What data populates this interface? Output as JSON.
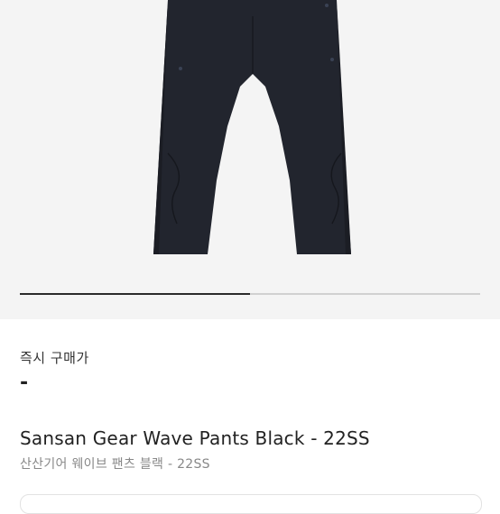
{
  "image_carousel": {
    "progress_fraction": 0.5,
    "alt": "pants-photo"
  },
  "price": {
    "label": "즉시 구매가",
    "value": "-"
  },
  "product": {
    "title_en": "Sansan Gear Wave Pants Black - 22SS",
    "title_ko": "산산기어 웨이브 팬츠 블랙 - 22SS"
  },
  "colors": {
    "background": "#f4f4f4",
    "pants": "#22252e",
    "progress_active": "#2a2a2a"
  }
}
